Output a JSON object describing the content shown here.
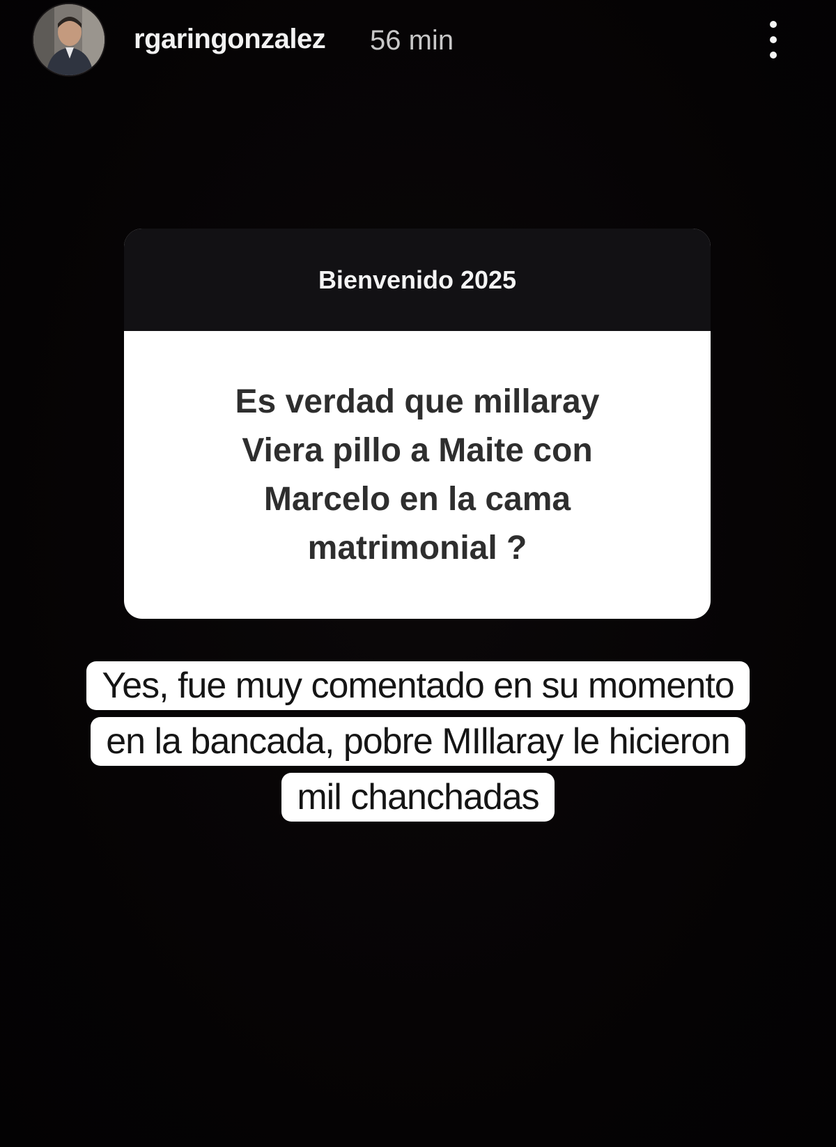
{
  "header": {
    "username": "rgaringonzalez",
    "time_ago": "56 min",
    "avatar_icon": "user-avatar",
    "more_icon": "more-vertical-icon"
  },
  "question_sticker": {
    "title": "Bienvenido 2025",
    "question": "Es verdad que millaray Viera pillo a Maite con Marcelo en la cama matrimonial ?"
  },
  "answer": {
    "text": "Yes, fue muy comentado en su momento en la bancada, pobre MIllaray le hicieron mil chanchadas"
  },
  "colors": {
    "background": "#060405",
    "sticker_header": "#121114",
    "sticker_body": "#ffffff",
    "caption_bg": "#ffffff",
    "caption_text": "#151515"
  }
}
